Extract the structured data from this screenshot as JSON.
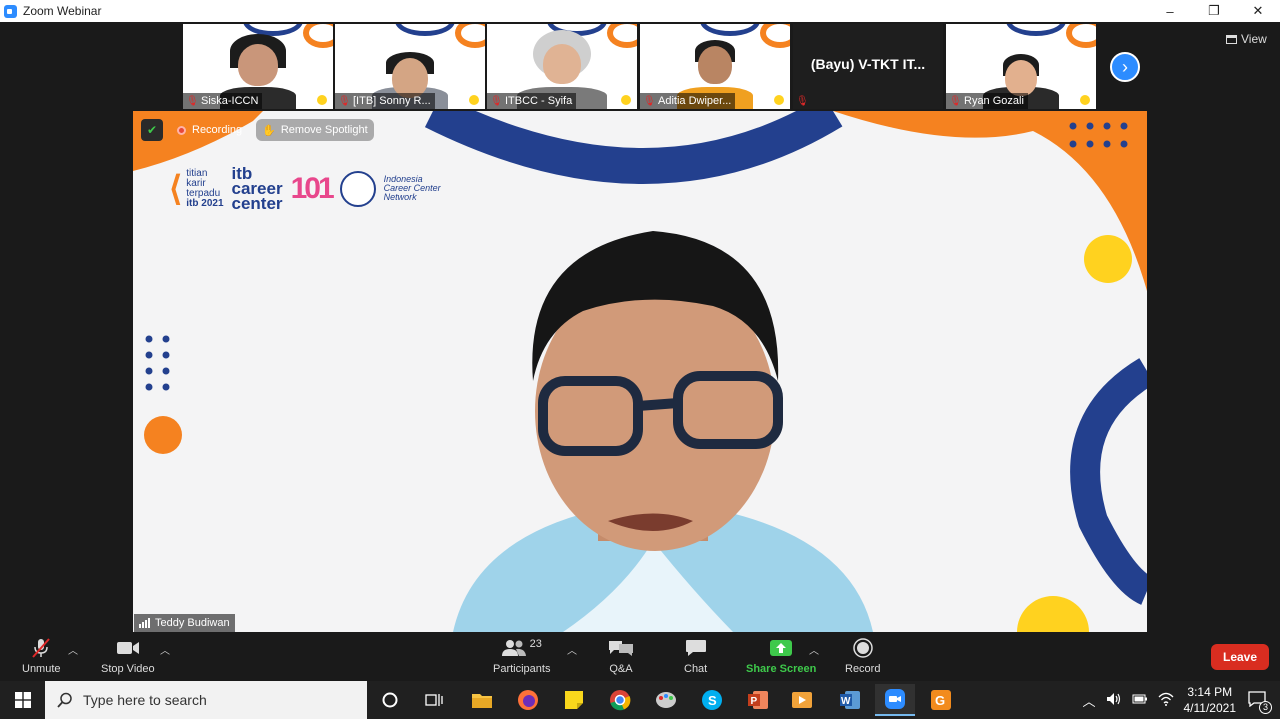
{
  "window": {
    "title": "Zoom Webinar",
    "minimize": "–",
    "restore": "❐",
    "close": "✕"
  },
  "thumbnails": [
    {
      "name": "Siska-ICCN"
    },
    {
      "name": "[ITB] Sonny R..."
    },
    {
      "name": "ITBCC - Syifa"
    },
    {
      "name": "Aditia Dwiper..."
    },
    {
      "name": "(Bayu) V-TKT IT..."
    },
    {
      "name": "Ryan Gozali"
    }
  ],
  "view_button": {
    "label": "View"
  },
  "spotlight": {
    "recording_label": "Recording",
    "remove_spotlight_label": "Remove Spotlight",
    "speaker_name": "Teddy Budiwan",
    "logos": {
      "tkt_line1": "titian",
      "tkt_line2": "karir",
      "tkt_line3": "terpadu",
      "tkt_line4": "itb  2021",
      "itb_line1": "itb",
      "itb_line2": "career",
      "itb_line3": "center",
      "centennial": "101",
      "iccn_line1": "Indonesia",
      "iccn_line2": "Career Center",
      "iccn_line3": "Network"
    }
  },
  "toolbar": {
    "unmute": "Unmute",
    "stop_video": "Stop Video",
    "participants": "Participants",
    "participants_count": "23",
    "qa": "Q&A",
    "chat": "Chat",
    "share_screen": "Share Screen",
    "record": "Record",
    "leave": "Leave",
    "share_color": "#3ec94b"
  },
  "taskbar": {
    "search_placeholder": "Type here to search",
    "time": "3:14 PM",
    "date": "4/11/2021",
    "notification_count": "3"
  }
}
